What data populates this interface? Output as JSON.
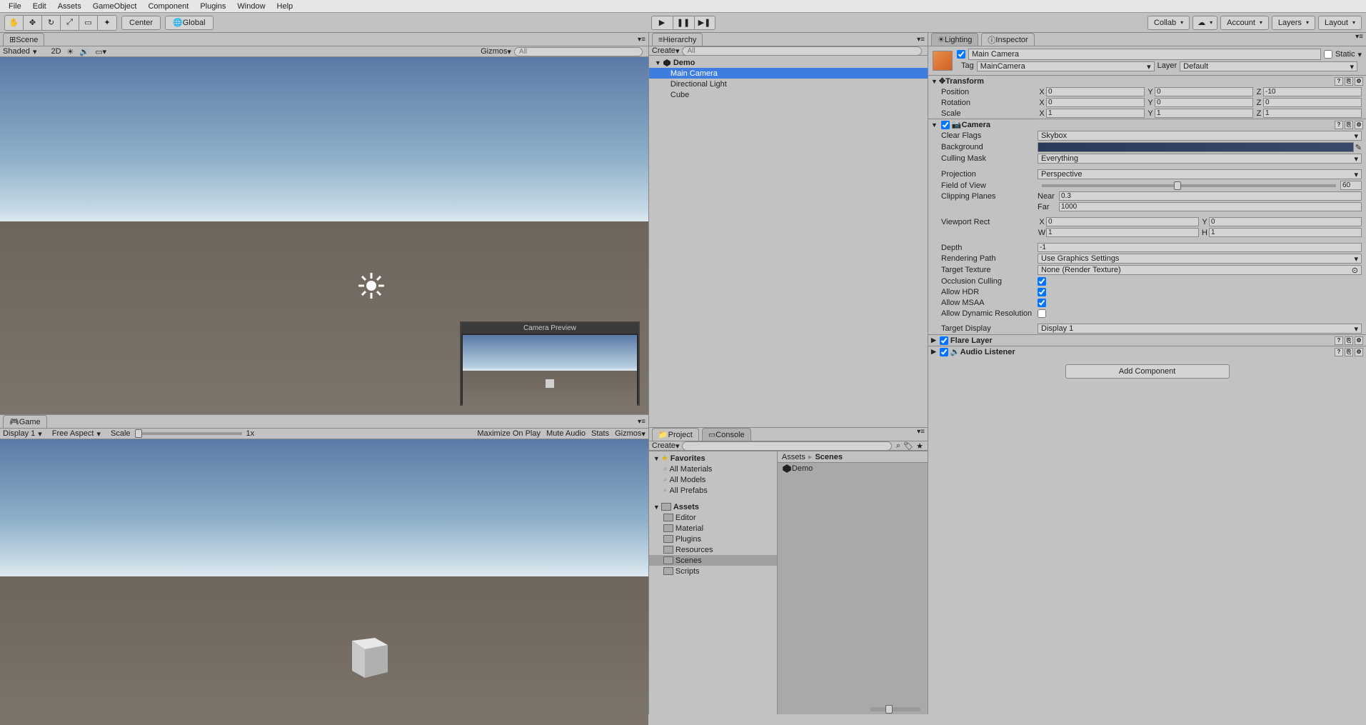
{
  "menu": [
    "File",
    "Edit",
    "Assets",
    "GameObject",
    "Component",
    "Plugins",
    "Window",
    "Help"
  ],
  "toolbar": {
    "pivot": "Center",
    "space": "Global",
    "collab": "Collab",
    "account": "Account",
    "layers": "Layers",
    "layout": "Layout"
  },
  "scene": {
    "tab": "Scene",
    "shading": "Shaded",
    "mode2d": "2D",
    "gizmos": "Gizmos",
    "search_placeholder": "All",
    "camera_preview": "Camera Preview"
  },
  "game": {
    "tab": "Game",
    "display": "Display 1",
    "aspect": "Free Aspect",
    "scale_label": "Scale",
    "scale_value": "1x",
    "max_on_play": "Maximize On Play",
    "mute": "Mute Audio",
    "stats": "Stats",
    "gizmos": "Gizmos"
  },
  "hierarchy": {
    "tab": "Hierarchy",
    "create": "Create",
    "search_placeholder": "All",
    "scene_name": "Demo",
    "items": [
      "Main Camera",
      "Directional Light",
      "Cube"
    ]
  },
  "project": {
    "tab_project": "Project",
    "tab_console": "Console",
    "create": "Create",
    "favorites": "Favorites",
    "fav_items": [
      "All Materials",
      "All Models",
      "All Prefabs"
    ],
    "assets": "Assets",
    "folders": [
      "Editor",
      "Material",
      "Plugins",
      "Resources",
      "Scenes",
      "Scripts"
    ],
    "breadcrumb": [
      "Assets",
      "Scenes"
    ],
    "content_item": "Demo"
  },
  "inspector": {
    "tab_lighting": "Lighting",
    "tab_inspector": "Inspector",
    "object_name": "Main Camera",
    "static_label": "Static",
    "tag_label": "Tag",
    "tag_value": "MainCamera",
    "layer_label": "Layer",
    "layer_value": "Default",
    "transform": {
      "title": "Transform",
      "position": "Position",
      "pos": {
        "x": "0",
        "y": "0",
        "z": "-10"
      },
      "rotation": "Rotation",
      "rot": {
        "x": "0",
        "y": "0",
        "z": "0"
      },
      "scale": "Scale",
      "scl": {
        "x": "1",
        "y": "1",
        "z": "1"
      }
    },
    "camera": {
      "title": "Camera",
      "clear_flags": "Clear Flags",
      "clear_flags_val": "Skybox",
      "background": "Background",
      "culling_mask": "Culling Mask",
      "culling_mask_val": "Everything",
      "projection": "Projection",
      "projection_val": "Perspective",
      "fov": "Field of View",
      "fov_val": "60",
      "clipping": "Clipping Planes",
      "near": "Near",
      "near_val": "0.3",
      "far": "Far",
      "far_val": "1000",
      "viewport": "Viewport Rect",
      "vx": "0",
      "vy": "0",
      "vw": "1",
      "vh": "1",
      "depth": "Depth",
      "depth_val": "-1",
      "rendering_path": "Rendering Path",
      "rendering_path_val": "Use Graphics Settings",
      "target_texture": "Target Texture",
      "target_texture_val": "None (Render Texture)",
      "occlusion": "Occlusion Culling",
      "hdr": "Allow HDR",
      "msaa": "Allow MSAA",
      "dyn_res": "Allow Dynamic Resolution",
      "target_display": "Target Display",
      "target_display_val": "Display 1"
    },
    "flare_layer": "Flare Layer",
    "audio_listener": "Audio Listener",
    "add_component": "Add Component"
  }
}
